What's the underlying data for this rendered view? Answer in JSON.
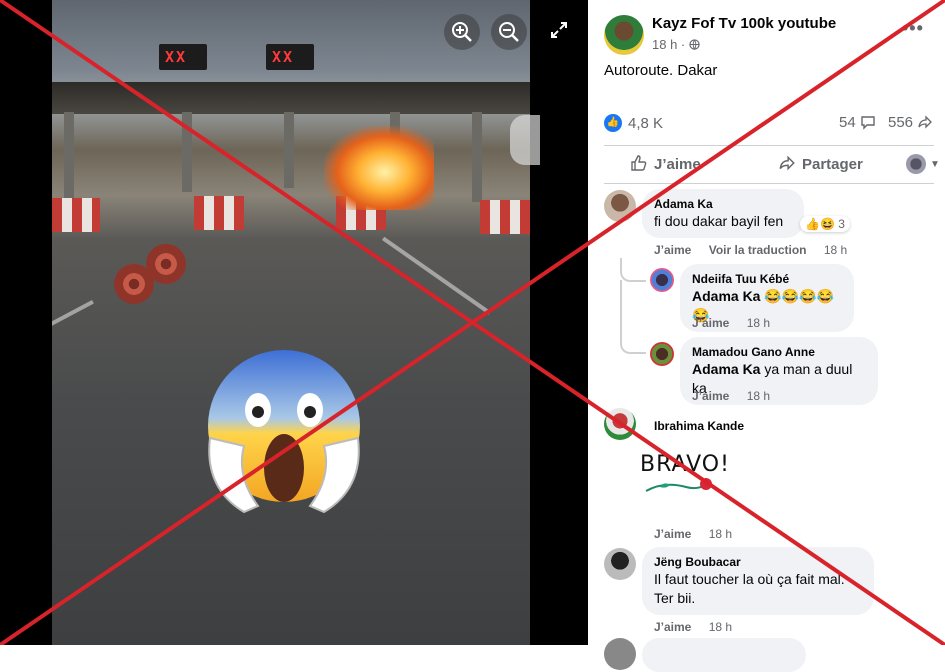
{
  "viewer": {
    "zoom_in_icon": "zoom-in-icon",
    "zoom_out_icon": "zoom-out-icon",
    "expand_icon": "expand-icon",
    "sign_left": "XX",
    "sign_right": "XX"
  },
  "post": {
    "author": "Kayz Fof Tv 100k youtube",
    "time": "18 h ·",
    "audience_icon": "globe-icon",
    "more": "•••",
    "caption": "Autoroute. Dakar",
    "reaction_count": "4,8 K",
    "comment_count": "54",
    "share_count": "556",
    "like_label": "J’aime",
    "share_label": "Partager"
  },
  "comments": [
    {
      "name": "Adama Ka",
      "text": "fi dou dakar bayil fen",
      "reaction_count": "3",
      "like": "J’aime",
      "translate": "Voir la traduction",
      "time": "18 h"
    },
    {
      "name": "Ndeiifa Tuu Kébé",
      "mention": "Adama Ka",
      "text": "😂😂😂😂😂",
      "like": "J’aime",
      "time": "18 h"
    },
    {
      "name": "Mamadou Gano Anne",
      "mention": "Adama Ka",
      "text": "ya man a duul ka",
      "like": "J’aime",
      "time": "18 h"
    },
    {
      "name": "Ibrahima Kande",
      "sticker": "BRAVO!",
      "like": "J’aime",
      "time": "18 h"
    },
    {
      "name": "Jëng Boubacar",
      "text_line1": "Il faut toucher la où ça fait mal.",
      "text_line2": "Ter bii.",
      "like": "J’aime",
      "time": "18 h"
    }
  ],
  "colors": {
    "cross": "#d8232a",
    "accent": "#1877f2"
  }
}
